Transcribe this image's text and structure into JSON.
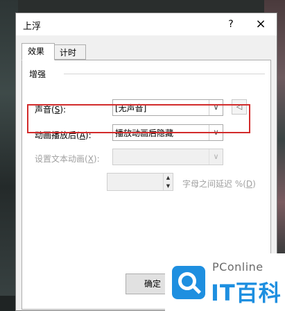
{
  "dialog": {
    "title": "上浮",
    "help": "?",
    "close": "×"
  },
  "tabs": [
    {
      "label": "效果",
      "active": true
    },
    {
      "label": "计时",
      "active": false
    }
  ],
  "group": {
    "label": "增强"
  },
  "rows": {
    "sound": {
      "label_prefix": "声音(",
      "key": "S",
      "label_suffix": "):",
      "value": "[无声音]"
    },
    "after_animation": {
      "label_prefix": "动画播放后(",
      "key": "A",
      "label_suffix": "):",
      "value": "播放动画后隐藏"
    },
    "animate_text": {
      "label_prefix": "设置文本动画(",
      "key": "X",
      "label_suffix": "):",
      "value": ""
    },
    "delay": {
      "value": "",
      "label_prefix": "字母之间延迟 %(",
      "key": "D",
      "label_suffix": ")"
    }
  },
  "buttons": {
    "ok": "确定"
  },
  "watermark": {
    "line1": "PConline",
    "line2": "IT百科"
  },
  "colors": {
    "highlight": "#d22b2b",
    "watermark_blue": "#1e8fe0"
  }
}
